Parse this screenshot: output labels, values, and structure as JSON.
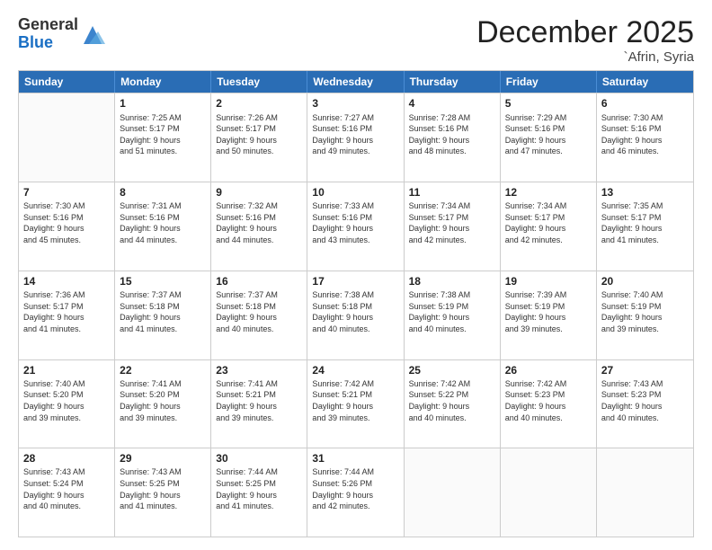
{
  "header": {
    "logo_general": "General",
    "logo_blue": "Blue",
    "month_title": "December 2025",
    "subtitle": "`Afrin, Syria"
  },
  "days_of_week": [
    "Sunday",
    "Monday",
    "Tuesday",
    "Wednesday",
    "Thursday",
    "Friday",
    "Saturday"
  ],
  "weeks": [
    [
      {
        "day": "",
        "lines": []
      },
      {
        "day": "1",
        "lines": [
          "Sunrise: 7:25 AM",
          "Sunset: 5:17 PM",
          "Daylight: 9 hours",
          "and 51 minutes."
        ]
      },
      {
        "day": "2",
        "lines": [
          "Sunrise: 7:26 AM",
          "Sunset: 5:17 PM",
          "Daylight: 9 hours",
          "and 50 minutes."
        ]
      },
      {
        "day": "3",
        "lines": [
          "Sunrise: 7:27 AM",
          "Sunset: 5:16 PM",
          "Daylight: 9 hours",
          "and 49 minutes."
        ]
      },
      {
        "day": "4",
        "lines": [
          "Sunrise: 7:28 AM",
          "Sunset: 5:16 PM",
          "Daylight: 9 hours",
          "and 48 minutes."
        ]
      },
      {
        "day": "5",
        "lines": [
          "Sunrise: 7:29 AM",
          "Sunset: 5:16 PM",
          "Daylight: 9 hours",
          "and 47 minutes."
        ]
      },
      {
        "day": "6",
        "lines": [
          "Sunrise: 7:30 AM",
          "Sunset: 5:16 PM",
          "Daylight: 9 hours",
          "and 46 minutes."
        ]
      }
    ],
    [
      {
        "day": "7",
        "lines": [
          "Sunrise: 7:30 AM",
          "Sunset: 5:16 PM",
          "Daylight: 9 hours",
          "and 45 minutes."
        ]
      },
      {
        "day": "8",
        "lines": [
          "Sunrise: 7:31 AM",
          "Sunset: 5:16 PM",
          "Daylight: 9 hours",
          "and 44 minutes."
        ]
      },
      {
        "day": "9",
        "lines": [
          "Sunrise: 7:32 AM",
          "Sunset: 5:16 PM",
          "Daylight: 9 hours",
          "and 44 minutes."
        ]
      },
      {
        "day": "10",
        "lines": [
          "Sunrise: 7:33 AM",
          "Sunset: 5:16 PM",
          "Daylight: 9 hours",
          "and 43 minutes."
        ]
      },
      {
        "day": "11",
        "lines": [
          "Sunrise: 7:34 AM",
          "Sunset: 5:17 PM",
          "Daylight: 9 hours",
          "and 42 minutes."
        ]
      },
      {
        "day": "12",
        "lines": [
          "Sunrise: 7:34 AM",
          "Sunset: 5:17 PM",
          "Daylight: 9 hours",
          "and 42 minutes."
        ]
      },
      {
        "day": "13",
        "lines": [
          "Sunrise: 7:35 AM",
          "Sunset: 5:17 PM",
          "Daylight: 9 hours",
          "and 41 minutes."
        ]
      }
    ],
    [
      {
        "day": "14",
        "lines": [
          "Sunrise: 7:36 AM",
          "Sunset: 5:17 PM",
          "Daylight: 9 hours",
          "and 41 minutes."
        ]
      },
      {
        "day": "15",
        "lines": [
          "Sunrise: 7:37 AM",
          "Sunset: 5:18 PM",
          "Daylight: 9 hours",
          "and 41 minutes."
        ]
      },
      {
        "day": "16",
        "lines": [
          "Sunrise: 7:37 AM",
          "Sunset: 5:18 PM",
          "Daylight: 9 hours",
          "and 40 minutes."
        ]
      },
      {
        "day": "17",
        "lines": [
          "Sunrise: 7:38 AM",
          "Sunset: 5:18 PM",
          "Daylight: 9 hours",
          "and 40 minutes."
        ]
      },
      {
        "day": "18",
        "lines": [
          "Sunrise: 7:38 AM",
          "Sunset: 5:19 PM",
          "Daylight: 9 hours",
          "and 40 minutes."
        ]
      },
      {
        "day": "19",
        "lines": [
          "Sunrise: 7:39 AM",
          "Sunset: 5:19 PM",
          "Daylight: 9 hours",
          "and 39 minutes."
        ]
      },
      {
        "day": "20",
        "lines": [
          "Sunrise: 7:40 AM",
          "Sunset: 5:19 PM",
          "Daylight: 9 hours",
          "and 39 minutes."
        ]
      }
    ],
    [
      {
        "day": "21",
        "lines": [
          "Sunrise: 7:40 AM",
          "Sunset: 5:20 PM",
          "Daylight: 9 hours",
          "and 39 minutes."
        ]
      },
      {
        "day": "22",
        "lines": [
          "Sunrise: 7:41 AM",
          "Sunset: 5:20 PM",
          "Daylight: 9 hours",
          "and 39 minutes."
        ]
      },
      {
        "day": "23",
        "lines": [
          "Sunrise: 7:41 AM",
          "Sunset: 5:21 PM",
          "Daylight: 9 hours",
          "and 39 minutes."
        ]
      },
      {
        "day": "24",
        "lines": [
          "Sunrise: 7:42 AM",
          "Sunset: 5:21 PM",
          "Daylight: 9 hours",
          "and 39 minutes."
        ]
      },
      {
        "day": "25",
        "lines": [
          "Sunrise: 7:42 AM",
          "Sunset: 5:22 PM",
          "Daylight: 9 hours",
          "and 40 minutes."
        ]
      },
      {
        "day": "26",
        "lines": [
          "Sunrise: 7:42 AM",
          "Sunset: 5:23 PM",
          "Daylight: 9 hours",
          "and 40 minutes."
        ]
      },
      {
        "day": "27",
        "lines": [
          "Sunrise: 7:43 AM",
          "Sunset: 5:23 PM",
          "Daylight: 9 hours",
          "and 40 minutes."
        ]
      }
    ],
    [
      {
        "day": "28",
        "lines": [
          "Sunrise: 7:43 AM",
          "Sunset: 5:24 PM",
          "Daylight: 9 hours",
          "and 40 minutes."
        ]
      },
      {
        "day": "29",
        "lines": [
          "Sunrise: 7:43 AM",
          "Sunset: 5:25 PM",
          "Daylight: 9 hours",
          "and 41 minutes."
        ]
      },
      {
        "day": "30",
        "lines": [
          "Sunrise: 7:44 AM",
          "Sunset: 5:25 PM",
          "Daylight: 9 hours",
          "and 41 minutes."
        ]
      },
      {
        "day": "31",
        "lines": [
          "Sunrise: 7:44 AM",
          "Sunset: 5:26 PM",
          "Daylight: 9 hours",
          "and 42 minutes."
        ]
      },
      {
        "day": "",
        "lines": []
      },
      {
        "day": "",
        "lines": []
      },
      {
        "day": "",
        "lines": []
      }
    ]
  ]
}
